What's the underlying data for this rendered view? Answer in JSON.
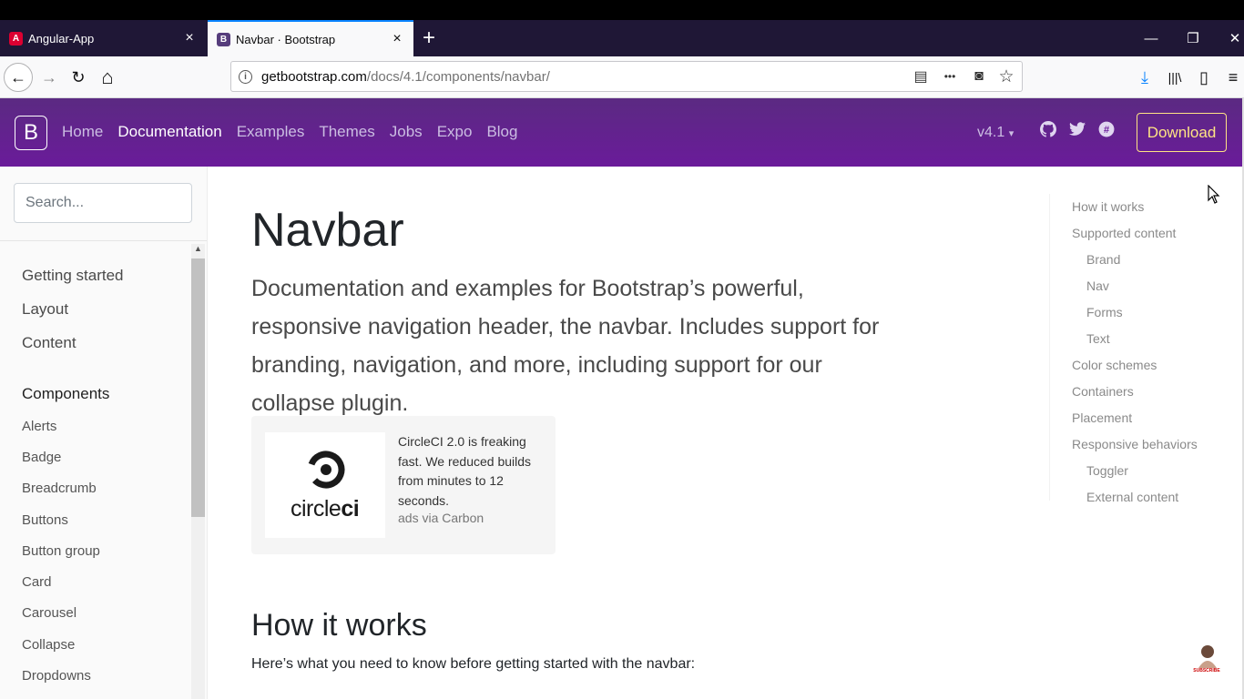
{
  "browser": {
    "tabs": [
      {
        "title": "Angular-App",
        "favicon": "A",
        "favicon_color": "#dd0031",
        "active": false
      },
      {
        "title": "Navbar · Bootstrap",
        "favicon": "B",
        "favicon_color": "#563d7c",
        "active": true
      }
    ],
    "new_tab_label": "+",
    "url_host": "getbootstrap.com",
    "url_path": "/docs/4.1/components/navbar/",
    "icons": {
      "back": "←",
      "forward": "→",
      "reload": "↻",
      "home": "⌂",
      "reader": "▤",
      "more": "•••",
      "pocket": "◙",
      "bookmark": "☆",
      "download": "⤓",
      "library": "|||\\",
      "sidebar": "▯",
      "menu": "≡",
      "minimize": "—",
      "restore": "❐",
      "close": "✕",
      "tab_close": "×",
      "info": "i"
    }
  },
  "navbar": {
    "logo": "B",
    "links": [
      {
        "label": "Home",
        "active": false
      },
      {
        "label": "Documentation",
        "active": true
      },
      {
        "label": "Examples",
        "active": false
      },
      {
        "label": "Themes",
        "active": false
      },
      {
        "label": "Jobs",
        "active": false
      },
      {
        "label": "Expo",
        "active": false
      },
      {
        "label": "Blog",
        "active": false
      }
    ],
    "version": "v4.1",
    "version_caret": "▾",
    "social_icons": [
      "github-icon",
      "twitter-icon",
      "slack-icon"
    ],
    "download_label": "Download",
    "brand_color": "#563d7c",
    "download_color": "#ffe484"
  },
  "sidebar": {
    "search_placeholder": "Search...",
    "groups": [
      "Getting started",
      "Layout",
      "Content",
      "Components"
    ],
    "links": [
      "Alerts",
      "Badge",
      "Breadcrumb",
      "Buttons",
      "Button group",
      "Card",
      "Carousel",
      "Collapse",
      "Dropdowns"
    ]
  },
  "main": {
    "title": "Navbar",
    "lead": "Documentation and examples for Bootstrap’s powerful, responsive navigation header, the navbar. Includes support for branding, navigation, and more, including support for our collapse plugin.",
    "ad": {
      "brand_light": "circle",
      "brand_bold": "ci",
      "text": "CircleCI 2.0 is freaking fast. We reduced builds from minutes to 12 seconds.",
      "powered_by": "ads via Carbon"
    },
    "section_title": "How it works",
    "section_text": "Here’s what you need to know before getting started with the navbar:"
  },
  "toc": [
    {
      "label": "How it works",
      "level": 1
    },
    {
      "label": "Supported content",
      "level": 1
    },
    {
      "label": "Brand",
      "level": 2
    },
    {
      "label": "Nav",
      "level": 2
    },
    {
      "label": "Forms",
      "level": 2
    },
    {
      "label": "Text",
      "level": 2
    },
    {
      "label": "Color schemes",
      "level": 1
    },
    {
      "label": "Containers",
      "level": 1
    },
    {
      "label": "Placement",
      "level": 1
    },
    {
      "label": "Responsive behaviors",
      "level": 1
    },
    {
      "label": "Toggler",
      "level": 2
    },
    {
      "label": "External content",
      "level": 2
    }
  ],
  "subscribe_label": "SUBSCRIBE"
}
